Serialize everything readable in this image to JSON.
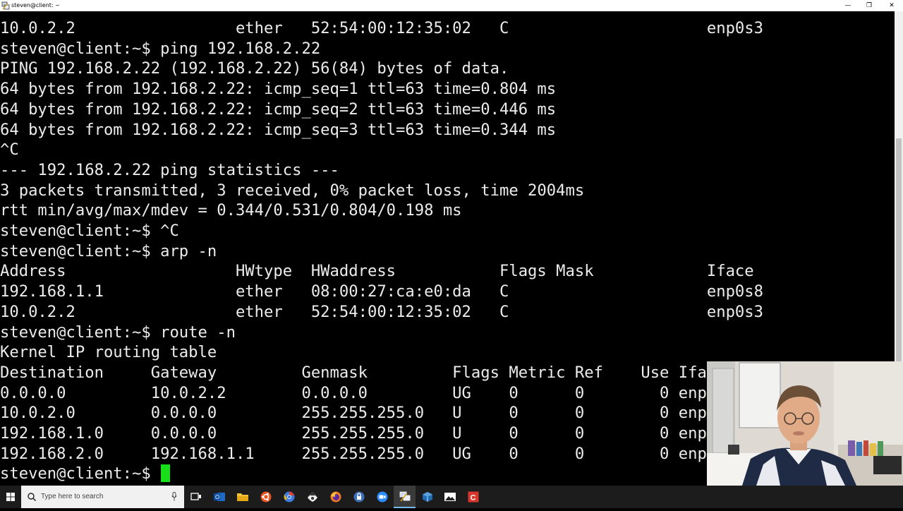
{
  "window": {
    "title": "steven@client: ~",
    "minimize_glyph": "—",
    "maximize_glyph": "❐",
    "close_glyph": "✕"
  },
  "terminal": {
    "lines": [
      "10.0.2.2                 ether   52:54:00:12:35:02   C                     enp0s3",
      "steven@client:~$ ping 192.168.2.22",
      "PING 192.168.2.22 (192.168.2.22) 56(84) bytes of data.",
      "64 bytes from 192.168.2.22: icmp_seq=1 ttl=63 time=0.804 ms",
      "64 bytes from 192.168.2.22: icmp_seq=2 ttl=63 time=0.446 ms",
      "64 bytes from 192.168.2.22: icmp_seq=3 ttl=63 time=0.344 ms",
      "^C",
      "--- 192.168.2.22 ping statistics ---",
      "3 packets transmitted, 3 received, 0% packet loss, time 2004ms",
      "rtt min/avg/max/mdev = 0.344/0.531/0.804/0.198 ms",
      "steven@client:~$ ^C",
      "steven@client:~$ arp -n",
      "Address                  HWtype  HWaddress           Flags Mask            Iface",
      "192.168.1.1              ether   08:00:27:ca:e0:da   C                     enp0s8",
      "10.0.2.2                 ether   52:54:00:12:35:02   C                     enp0s3",
      "steven@client:~$ route -n",
      "Kernel IP routing table",
      "Destination     Gateway         Genmask         Flags Metric Ref    Use Ifa",
      "0.0.0.0         10.0.2.2        0.0.0.0         UG    0      0        0 enp",
      "10.0.2.0        0.0.0.0         255.255.255.0   U     0      0        0 enp",
      "192.168.1.0     0.0.0.0         255.255.255.0   U     0      0        0 enp",
      "192.168.2.0     192.168.1.1     255.255.255.0   UG    0      0        0 enp",
      "steven@client:~$ "
    ],
    "cursor_color": "#18e018",
    "text_color": "#ececec",
    "background": "#000000"
  },
  "taskbar": {
    "search_placeholder": "Type here to search",
    "icons": [
      "task-view-icon",
      "outlook-icon",
      "file-explorer-icon",
      "ubuntu-icon",
      "chrome-icon",
      "inkscape-icon",
      "firefox-icon",
      "keepass-icon",
      "zoom-icon",
      "putty-icon",
      "virtualbox-icon",
      "photos-icon",
      "c-app-icon"
    ],
    "active_app": "putty-icon"
  }
}
